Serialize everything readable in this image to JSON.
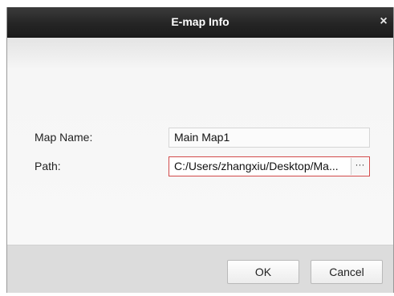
{
  "dialog": {
    "title": "E-map Info",
    "close_glyph": "×"
  },
  "form": {
    "map_name_label": "Map Name:",
    "map_name_value": "Main Map1",
    "path_label": "Path:",
    "path_value": "C:/Users/zhangxiu/Desktop/Ma...",
    "browse_label": "···"
  },
  "buttons": {
    "ok": "OK",
    "cancel": "Cancel"
  },
  "colors": {
    "titlebar": "#252525",
    "path_border_error": "#d14a4a"
  }
}
